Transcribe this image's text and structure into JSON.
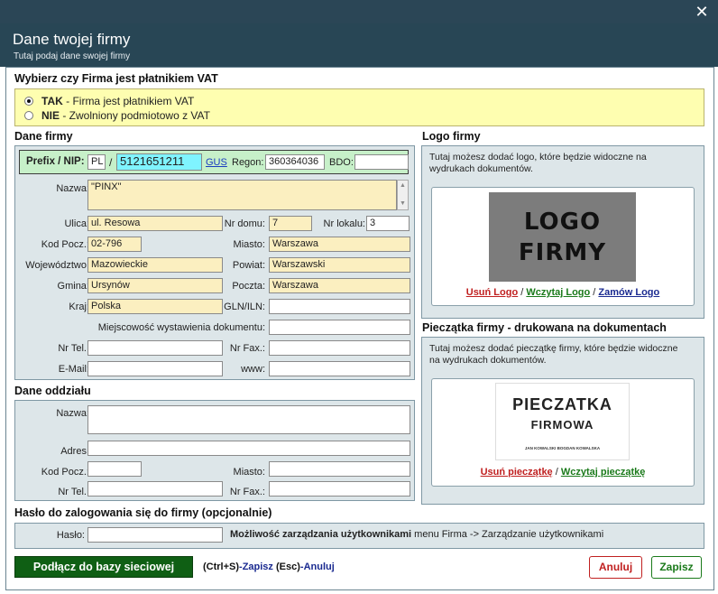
{
  "window": {
    "close_glyph": "✕"
  },
  "header": {
    "title": "Dane twojej firmy",
    "subtitle": "Tutaj podaj dane swojej firmy"
  },
  "vat": {
    "heading": "Wybierz czy Firma jest płatnikiem VAT",
    "options": [
      {
        "key": "TAK",
        "desc": " - Firma jest płatnikiem VAT",
        "selected": true
      },
      {
        "key": "NIE",
        "desc": " - Zwolniony podmiotowo z VAT",
        "selected": false
      }
    ]
  },
  "company": {
    "heading": "Dane firmy",
    "prefix_label": "Prefix / NIP:",
    "prefix": "PL",
    "slash": "/",
    "nip": "5121651211",
    "gus": "GUS",
    "regon_label": "Regon:",
    "regon": "360364036",
    "bdo_label": "BDO:",
    "bdo": "",
    "name_label": "Nazwa:",
    "name": "\"PINX\"",
    "street_label": "Ulica:",
    "street": "ul. Resowa",
    "house_label": "Nr domu:",
    "house": "7",
    "flat_label": "Nr lokalu:",
    "flat": "3",
    "zip_label": "Kod Pocz.:",
    "zip": "02-796",
    "city_label": "Miasto:",
    "city": "Warszawa",
    "voivodeship_label": "Województwo:",
    "voivodeship": "Mazowieckie",
    "county_label": "Powiat:",
    "county": "Warszawski",
    "commune_label": "Gmina:",
    "commune": "Ursynów",
    "post_label": "Poczta:",
    "post": "Warszawa",
    "country_label": "Kraj:",
    "country": "Polska",
    "gln_label": "GLN/ILN:",
    "gln": "",
    "issue_place_label": "Miejscowość wystawienia dokumentu:",
    "issue_place": "",
    "phone_label": "Nr Tel.:",
    "phone": "",
    "fax_label": "Nr Fax.:",
    "fax": "",
    "email_label": "E-Mail:",
    "email": "",
    "www_label": "www:",
    "www": ""
  },
  "branch": {
    "heading": "Dane oddziału",
    "name_label": "Nazwa:",
    "address_label": "Adres:",
    "zip_label": "Kod Pocz.:",
    "city_label": "Miasto:",
    "phone_label": "Nr Tel.:",
    "fax_label": "Nr Fax.:"
  },
  "logo": {
    "heading": "Logo firmy",
    "info": "Tutaj możesz dodać logo, które będzie widoczne na wydrukach dokumentów.",
    "image_line1": "LOGO",
    "image_line2": "FIRMY",
    "remove": "Usuń Logo",
    "load": "Wczytaj Logo",
    "order": "Zamów Logo",
    "sep": " / "
  },
  "stamp": {
    "heading": "Pieczątka firmy - drukowana na dokumentach",
    "info": "Tutaj możesz dodać pieczątkę firmy, które będzie widoczne na wydrukach dokumentów.",
    "image_line1": "PIECZATKA",
    "image_line2": "FIRMOWA",
    "image_line3": "JAN KOWALSKI   BOGDAN KOWALSKA",
    "remove": "Usuń pieczątkę",
    "load": "Wczytaj pieczątkę",
    "sep": " / "
  },
  "password": {
    "heading": "Hasło do zalogowania się do firmy (opcjonalnie)",
    "label": "Hasło:",
    "value": "",
    "note_bold": "Możliwość zarządzania użytkownikami",
    "note_rest": " menu Firma -> Zarządzanie użytkownikami"
  },
  "footer": {
    "network": "Podłącz do bazy sieciowej",
    "hint_key1": "(Ctrl+S)",
    "hint_act1": "-Zapisz",
    "hint_key2": " (Esc)",
    "hint_act2": "-Anuluj",
    "cancel": "Anuluj",
    "save": "Zapisz"
  },
  "colors": {
    "header": "#284655",
    "field_yellow": "#fbefc0",
    "nip_cyan": "#7ff4ff",
    "save_green": "#1a7a1a",
    "cancel_red": "#c02020",
    "network_btn": "#0f5f14"
  }
}
